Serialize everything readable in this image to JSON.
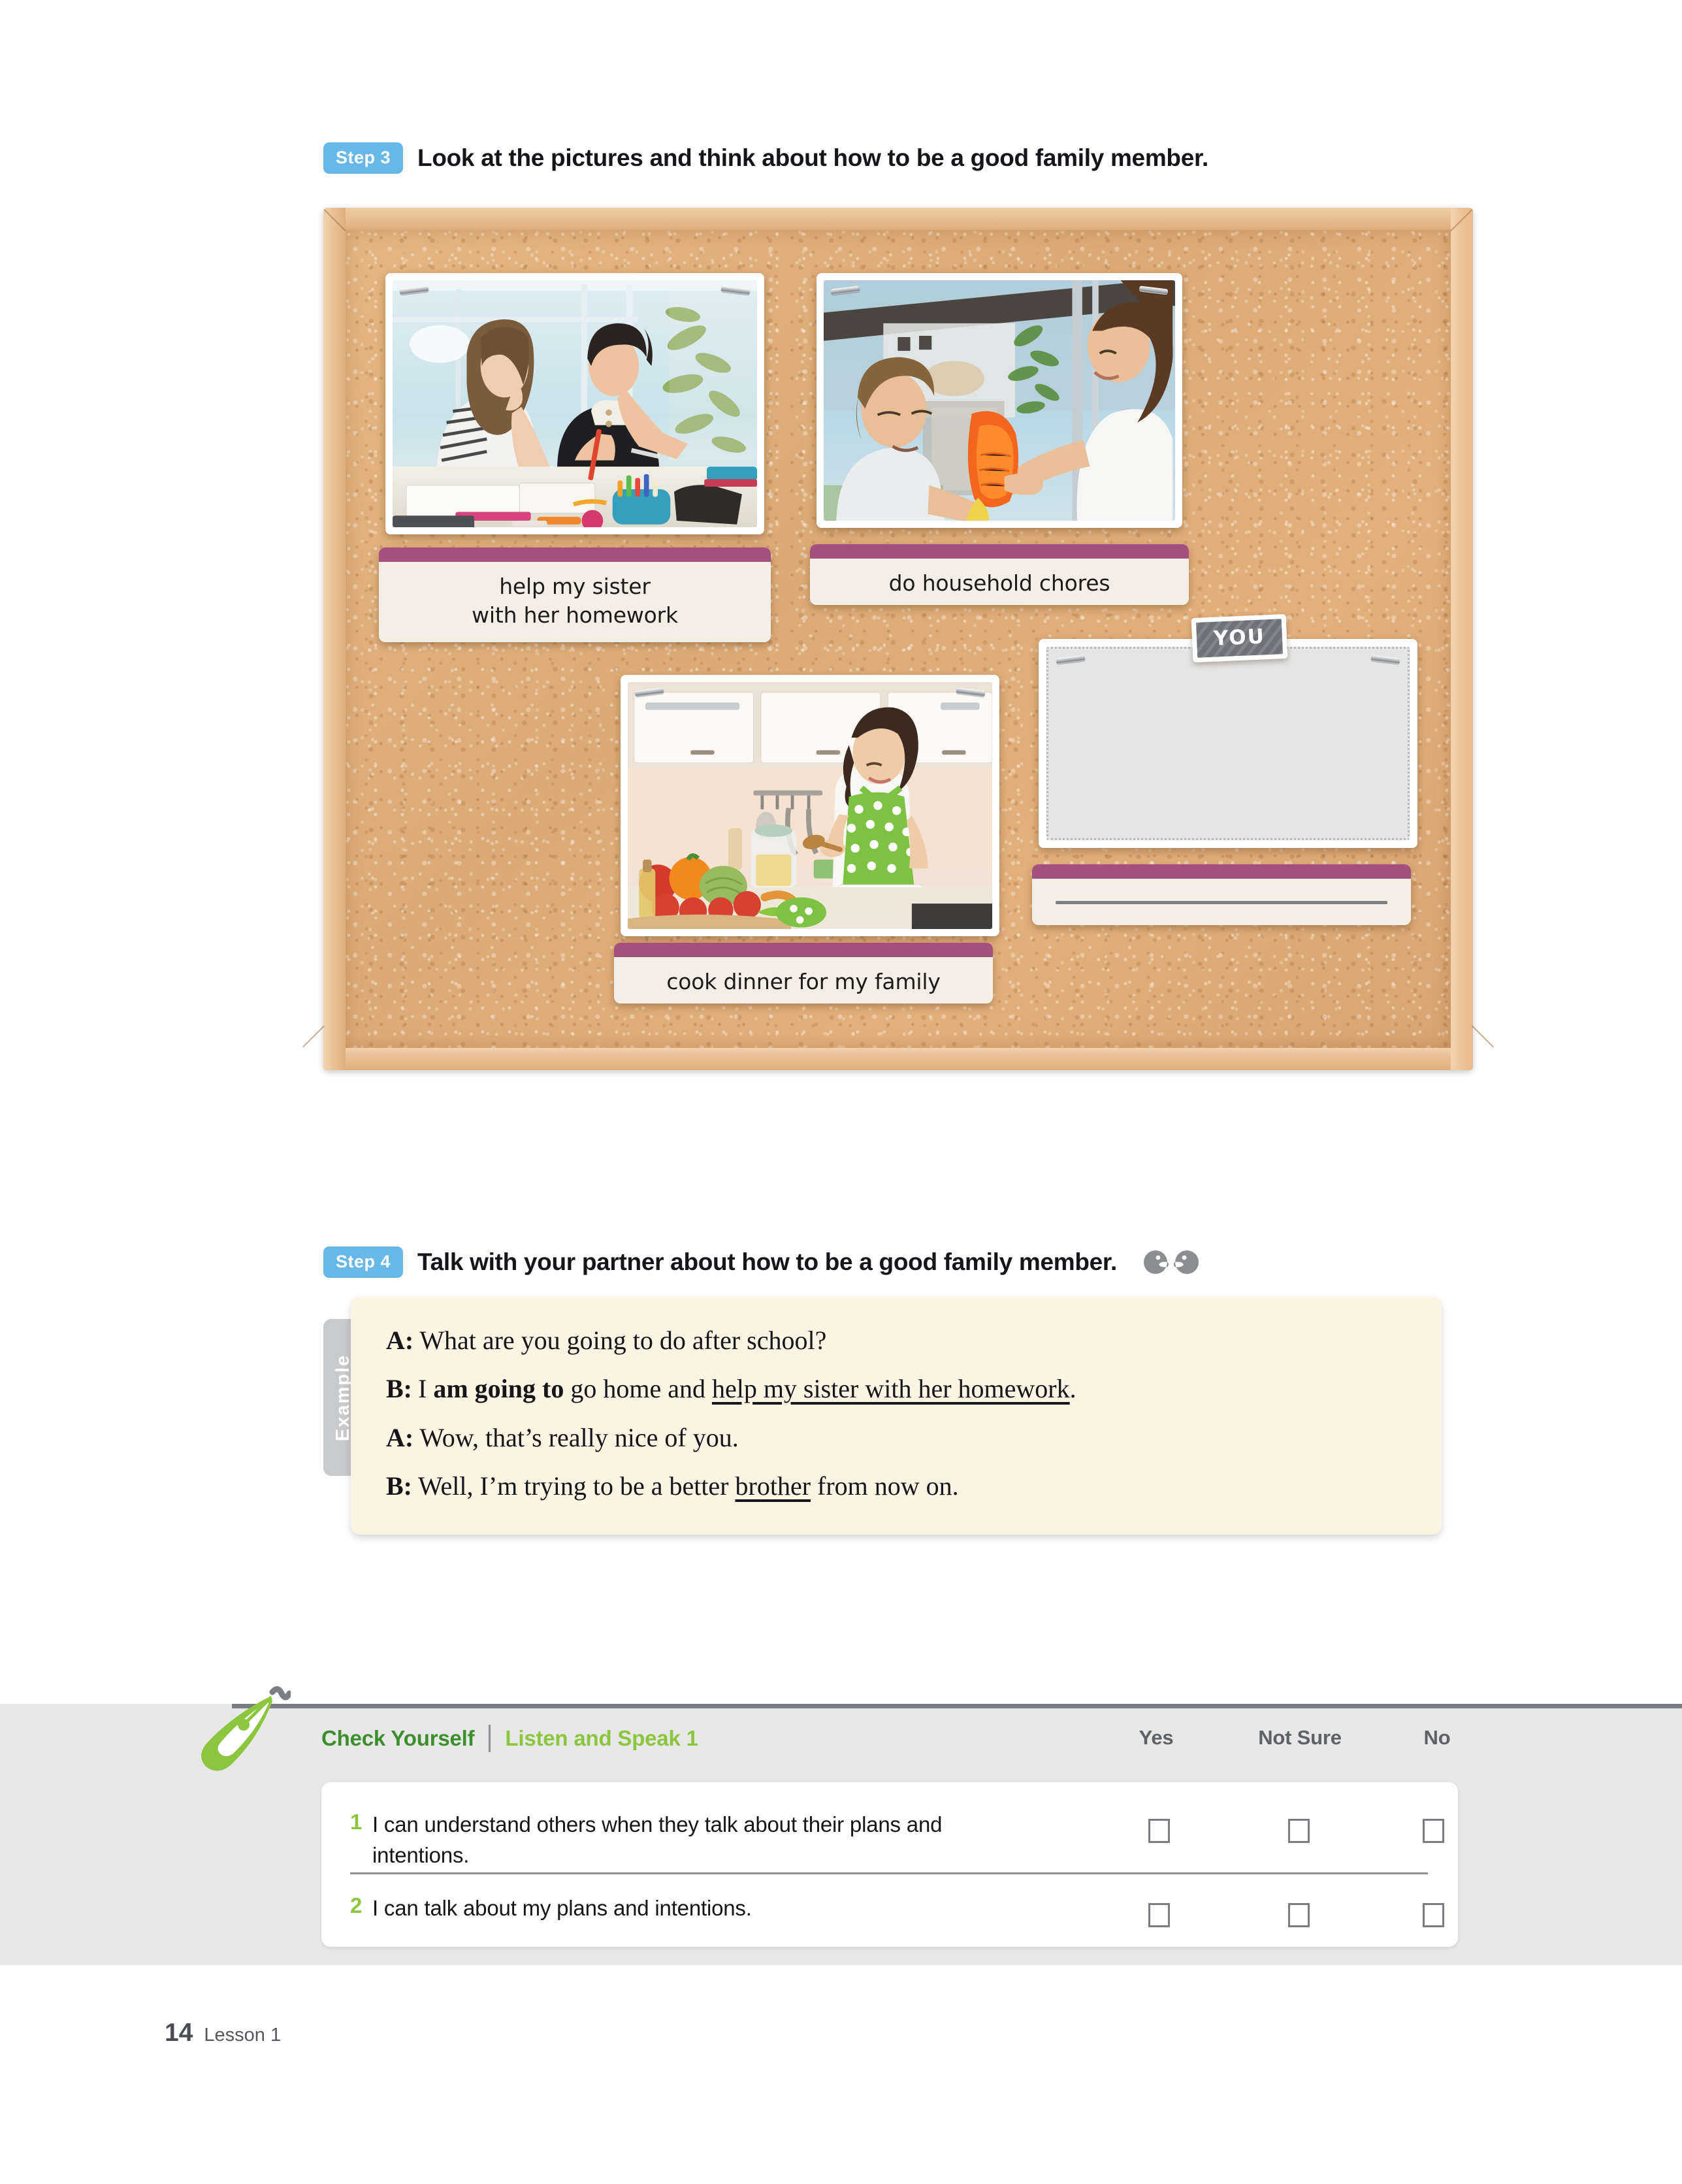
{
  "step3": {
    "badge": "Step 3",
    "instruction": "Look at the pictures and think about how to be a good family member."
  },
  "step4": {
    "badge": "Step 4",
    "instruction": "Talk with your partner about how to be a good family member.",
    "icons": [
      "speaker-head-left-icon",
      "speaker-head-right-icon"
    ]
  },
  "corkboard": {
    "cards": [
      {
        "id": "help-sister",
        "photo_alt": "two teenagers studying together at a desk with notebooks and a pencil case",
        "label_lines": [
          "help my sister",
          "with her homework"
        ]
      },
      {
        "id": "household-chores",
        "photo_alt": "a boy and a girl cleaning a glass window with an orange cloth",
        "label_lines": [
          "do household chores"
        ]
      },
      {
        "id": "cook-dinner",
        "photo_alt": "a woman in a green polka dot apron cooking at a stove with fresh vegetables",
        "label_lines": [
          "cook dinner for my family"
        ]
      },
      {
        "id": "you-blank",
        "tag": "YOU",
        "label_lines": [
          ""
        ]
      }
    ]
  },
  "example": {
    "tab_label": "Example",
    "lines": [
      {
        "speaker": "A:",
        "parts": [
          {
            "text": "What are you going to do after school?",
            "style": "plain"
          }
        ]
      },
      {
        "speaker": "B:",
        "parts": [
          {
            "text": "I ",
            "style": "plain"
          },
          {
            "text": "am going to",
            "style": "bold"
          },
          {
            "text": " go home and ",
            "style": "plain"
          },
          {
            "text": "help my sister with her homework",
            "style": "underline"
          },
          {
            "text": ".",
            "style": "plain"
          }
        ]
      },
      {
        "speaker": "A:",
        "parts": [
          {
            "text": "Wow, that’s really nice of you.",
            "style": "plain"
          }
        ]
      },
      {
        "speaker": "B:",
        "parts": [
          {
            "text": "Well, I’m trying to be a better ",
            "style": "plain"
          },
          {
            "text": "brother",
            "style": "underline"
          },
          {
            "text": " from now on.",
            "style": "plain"
          }
        ]
      }
    ]
  },
  "check_yourself": {
    "icon": "green-pen-nib-icon",
    "title": "Check Yourself",
    "subtitle": "Listen and Speak 1",
    "columns": [
      "Yes",
      "Not Sure",
      "No"
    ],
    "items": [
      {
        "num": "1",
        "text": "I can understand others when they talk about their plans and intentions."
      },
      {
        "num": "2",
        "text": "I can talk about my plans and intentions."
      }
    ]
  },
  "footer": {
    "page_number": "14",
    "lesson": "Lesson 1"
  },
  "colors": {
    "step_badge": "#67b7e8",
    "label_bar": "#a4507f",
    "title_green": "#3d8f2e",
    "subtitle_green": "#8cc63f",
    "band_gray": "#e8e8e8",
    "example_bg": "#faf5e2"
  }
}
